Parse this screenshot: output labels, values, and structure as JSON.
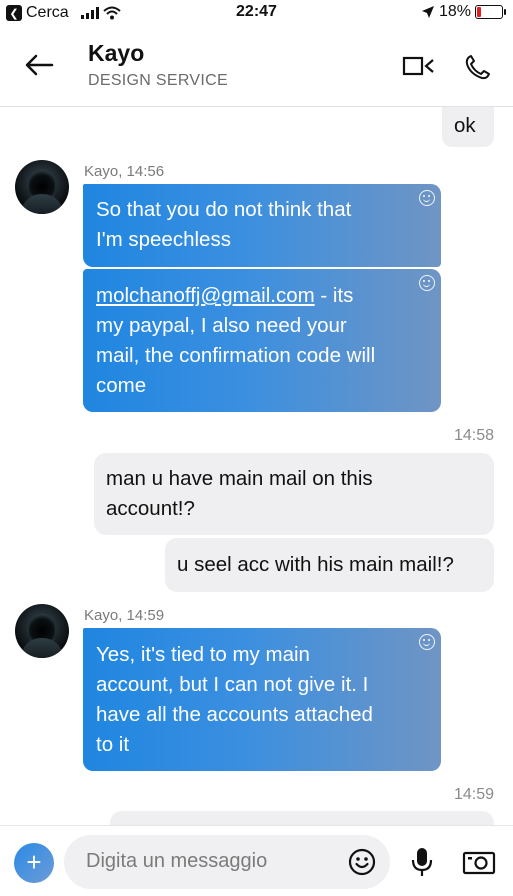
{
  "status_bar": {
    "carrier": "Cerca",
    "time": "22:47",
    "battery": "18%",
    "battery_level": 0.18,
    "battery_color": "#e0201c"
  },
  "header": {
    "name": "Kayo",
    "subtitle": "DESIGN SERVICE",
    "icons": [
      "back-arrow-icon",
      "video-call-icon",
      "phone-icon"
    ]
  },
  "messages": {
    "m0_text": "ok",
    "m1_meta": "Kayo, 14:56",
    "m1_line1": "So that you do not think that",
    "m1_line2": "I'm speechless",
    "m2_link": "molchanoffj@gmail.com",
    "m2_after_link": " - its",
    "m2_line2": "my paypal, I also need your",
    "m2_line3": "mail, the confirmation code will",
    "m2_line4": "come",
    "ts1": "14:58",
    "m3_line1": "man u have main mail on this",
    "m3_line2": "account!?",
    "m4_text": "u seel acc with his main mail!?",
    "m5_meta": "Kayo, 14:59",
    "m5_line1": "Yes, it's tied to my main",
    "m5_line2": "account, but I can not give it. I",
    "m5_line3": "have all the accounts attached",
    "m5_line4": "to it",
    "ts2": "14:59"
  },
  "composer": {
    "plus_label": "+",
    "placeholder": "Digita un messaggio",
    "icons": [
      "emoji-icon",
      "microphone-icon",
      "camera-icon"
    ]
  },
  "colors": {
    "incoming_start": "#1f86e0",
    "incoming_end": "#6f95c4",
    "outgoing_bg": "#efeff1"
  }
}
